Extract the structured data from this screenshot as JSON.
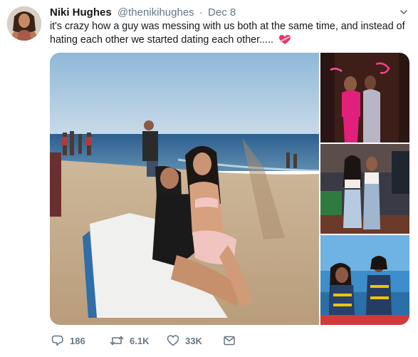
{
  "tweet": {
    "display_name": "Niki Hughes",
    "handle": "@thenikihughes",
    "separator": "·",
    "date": "Dec 8",
    "text": "it's crazy how a guy was messing with us both at the same time, and instead of hating each other we started dating each other.....",
    "text_emoji": "heart-with-ribbon"
  },
  "media": {
    "photos": [
      {
        "subject": "two women on the beach"
      },
      {
        "subject": "two women under pink neon sign"
      },
      {
        "subject": "two women on a street at night"
      },
      {
        "subject": "two women in life jackets"
      }
    ]
  },
  "actions": {
    "reply_count": "186",
    "retweet_count": "6.1K",
    "like_count": "33K",
    "icons": [
      "reply-icon",
      "retweet-icon",
      "like-icon",
      "direct-message-icon"
    ]
  },
  "colors": {
    "text": "#14171a",
    "secondary": "#657786"
  }
}
